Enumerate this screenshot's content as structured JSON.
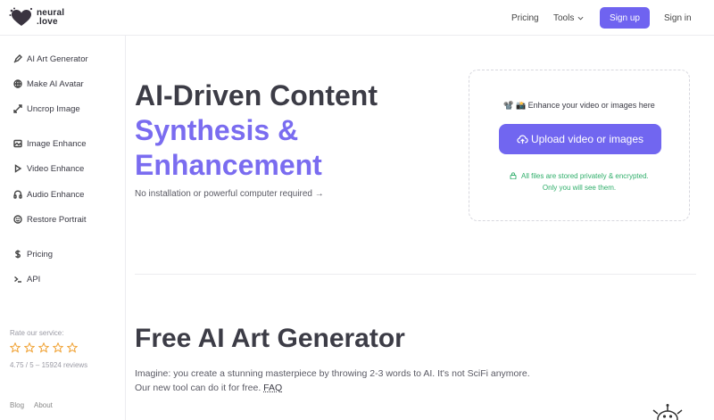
{
  "header": {
    "logo_line1": "neural",
    "logo_line2": ".love",
    "nav": {
      "pricing": "Pricing",
      "tools": "Tools",
      "signup": "Sign up",
      "signin": "Sign in"
    }
  },
  "sidebar": {
    "items": [
      {
        "label": "AI Art Generator",
        "icon": "pen-icon"
      },
      {
        "label": "Make AI Avatar",
        "icon": "globe-icon"
      },
      {
        "label": "Uncrop Image",
        "icon": "expand-icon"
      },
      {
        "label": "Image Enhance",
        "icon": "image-icon"
      },
      {
        "label": "Video Enhance",
        "icon": "play-icon"
      },
      {
        "label": "Audio Enhance",
        "icon": "headphones-icon"
      },
      {
        "label": "Restore Portrait",
        "icon": "smile-icon"
      },
      {
        "label": "Pricing",
        "icon": "dollar-icon"
      },
      {
        "label": "API",
        "icon": "terminal-icon"
      }
    ],
    "rate_title": "Rate our service:",
    "rating_text": "4.75 / 5 – 15924 reviews",
    "stars_count": 5,
    "footer": {
      "blog": "Blog",
      "about": "About"
    }
  },
  "hero": {
    "title_line1": "AI-Driven Content",
    "title_line2": "Synthesis &",
    "title_line3": "Enhancement",
    "subtitle": "No installation or powerful computer required →"
  },
  "upload": {
    "hint": "📽️ 📸 Enhance your video or images here",
    "button": "Upload video or images",
    "privacy_line1": "All files are stored privately & encrypted.",
    "privacy_line2": "Only you will see them."
  },
  "section": {
    "title": "Free AI Art Generator",
    "text_line1": "Imagine: you create a stunning masterpiece by throwing 2-3 words to AI. It's not SciFi anymore.",
    "text_line2": "Our new tool can do it for free.",
    "faq": "FAQ"
  },
  "colors": {
    "accent": "#7a6cf0",
    "button": "#6f63f0",
    "privacy_green": "#2fae6a",
    "star": "#f0a030"
  }
}
